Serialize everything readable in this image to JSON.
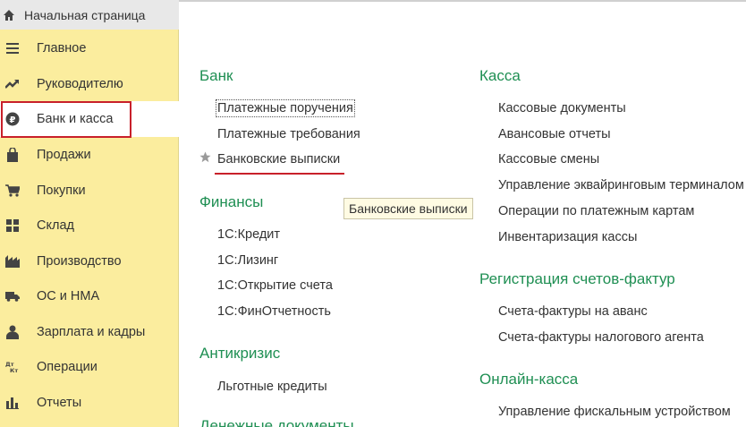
{
  "home_tab": {
    "label": "Начальная страница",
    "icon": "home-icon"
  },
  "sidebar": {
    "items": [
      {
        "label": "Главное",
        "icon": "menu-lines-icon"
      },
      {
        "label": "Руководителю",
        "icon": "trend-up-icon"
      },
      {
        "label": "Банк и касса",
        "icon": "ruble-coin-icon"
      },
      {
        "label": "Продажи",
        "icon": "shopping-bag-icon"
      },
      {
        "label": "Покупки",
        "icon": "cart-icon"
      },
      {
        "label": "Склад",
        "icon": "warehouse-grid-icon"
      },
      {
        "label": "Производство",
        "icon": "factory-icon"
      },
      {
        "label": "ОС и НМА",
        "icon": "truck-icon"
      },
      {
        "label": "Зарплата и кадры",
        "icon": "person-icon"
      },
      {
        "label": "Операции",
        "icon": "dt-kt-icon"
      },
      {
        "label": "Отчеты",
        "icon": "bar-chart-icon"
      }
    ],
    "active_index": 2
  },
  "sections": {
    "bank": {
      "title": "Банк",
      "links": [
        "Платежные поручения",
        "Платежные требования",
        "Банковские выписки"
      ]
    },
    "finance": {
      "title": "Финансы",
      "links": [
        "1С:Кредит",
        "1С:Лизинг",
        "1С:Открытие счета",
        "1С:ФинОтчетность"
      ]
    },
    "anticrisis": {
      "title": "Антикризис",
      "links": [
        "Льготные кредиты"
      ]
    },
    "money_docs": {
      "title": "Денежные документы"
    },
    "kassa": {
      "title": "Касса",
      "links": [
        "Кассовые документы",
        "Авансовые отчеты",
        "Кассовые смены",
        "Управление эквайринговым терминалом",
        "Операции по платежным картам",
        "Инвентаризация кассы"
      ]
    },
    "invoices": {
      "title": "Регистрация счетов-фактур",
      "links": [
        "Счета-фактуры на аванс",
        "Счета-фактуры налогового агента"
      ]
    },
    "online_kassa": {
      "title": "Онлайн-касса",
      "links": [
        "Управление фискальным устройством"
      ]
    }
  },
  "tooltip": {
    "text": "Банковские выписки"
  },
  "colors": {
    "section_title": "#1f8f53",
    "sidebar_bg": "#fbed9e",
    "highlight_red": "#c8202a"
  }
}
